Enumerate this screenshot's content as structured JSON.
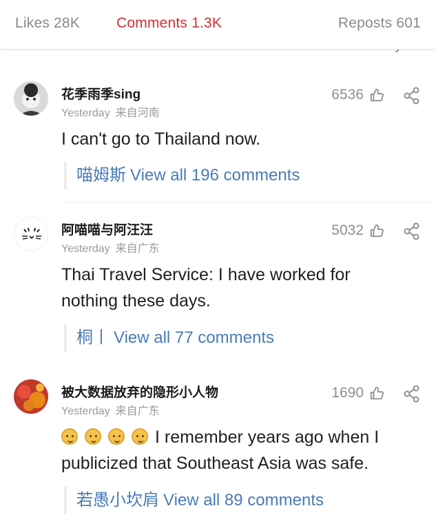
{
  "tabs": [
    {
      "label": "Likes",
      "count": "28K"
    },
    {
      "label": "Comments",
      "count": "1.3K"
    },
    {
      "label": "Reposts",
      "count": "601"
    }
  ],
  "sort_peek": "by hot",
  "comments": [
    {
      "username": "花季雨季sing",
      "time": "Yesterday",
      "location": "来自河南",
      "likes": "6536",
      "text": "I can't go to Thailand now.",
      "reply_user": "喵姆斯",
      "reply_link": "View all 196 comments"
    },
    {
      "username": "阿喵喵与阿汪汪",
      "time": "Yesterday",
      "location": "来自广东",
      "likes": "5032",
      "text": "Thai Travel Service: I have worked for nothing these days.",
      "reply_user": "桐丨",
      "reply_link": "View all 77 comments"
    },
    {
      "username": "被大数据放弃的隐形小人物",
      "time": "Yesterday",
      "location": "来自广东",
      "likes": "1690",
      "text": "I remember years ago when I publicized that Southeast Asia was safe.",
      "reply_user": "若愚小坎肩",
      "reply_link": "View all 89 comments"
    }
  ],
  "colors": {
    "accent": "#d32f2f",
    "link": "#4a7bb7",
    "muted": "#9a9a9a"
  }
}
